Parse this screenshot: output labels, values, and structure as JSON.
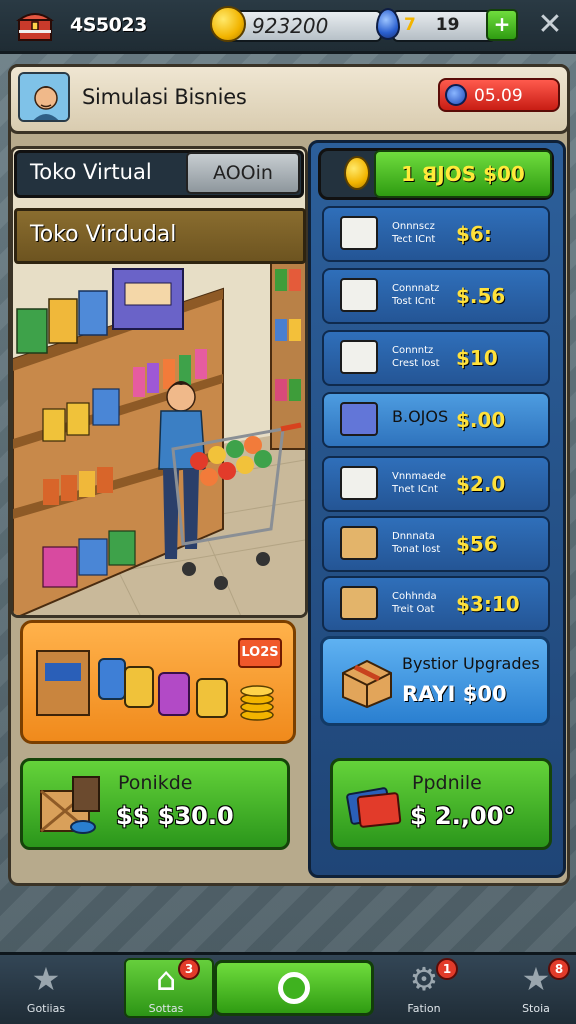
{
  "topbar": {
    "counter": "4S5023",
    "coins": "923200",
    "gems_level": "7",
    "gems": "19",
    "plus_label": "+",
    "close_label": "✕"
  },
  "header": {
    "title": "Simulasi Bisnies",
    "badge_value": "05.09"
  },
  "store": {
    "title": "Toko Virtual",
    "button": "AOOin",
    "name_plate": "Toko Virdudal",
    "promo_tag": "LO2S"
  },
  "left_buy": {
    "label": "Ponikde",
    "price": "$$ $30.0"
  },
  "right_panel": {
    "head_button": "1 ꓭJOS $00",
    "items": [
      {
        "label": "Onnnscz\nTect ICnt",
        "price": "$6:",
        "icon_color": "#f1f1ec"
      },
      {
        "label": "Connnatz\nTost ICnt",
        "price": "$.56",
        "icon_color": "#f1f1ec"
      },
      {
        "label": "Connntz\nCrest Iost",
        "price": "$10",
        "icon_color": "#f1f1ec"
      },
      {
        "label": "B.OJOS",
        "price": "$.00",
        "icon_color": "#6276d8",
        "highlight": true
      },
      {
        "label": "Vnnmaede\nTnet ICnt",
        "price": "$2.0",
        "icon_color": "#f1f1ec"
      },
      {
        "label": "Dnnnata\nTonat Iost",
        "price": "$56",
        "icon_color": "#e3b46a"
      },
      {
        "label": "Cohhnda\nTreit Oat",
        "price": "$3:10",
        "icon_color": "#e3b46a"
      }
    ],
    "upgrade": {
      "title": "Bystior Upgrades",
      "price": "RAYI $00"
    },
    "buy": {
      "label": "Ppdnile",
      "price": "$ 2.,00°"
    }
  },
  "bottom_nav": {
    "items": [
      {
        "label": "Gotiias",
        "badge": ""
      },
      {
        "label": "Sottas",
        "badge": "3"
      },
      {
        "label": "Fation",
        "badge": "1"
      },
      {
        "label": "Stoia",
        "badge": "8"
      }
    ]
  },
  "colors": {
    "accent_green": "#3fb21f",
    "accent_blue": "#245595",
    "accent_red": "#c81d14",
    "gold": "#ffe13b"
  }
}
